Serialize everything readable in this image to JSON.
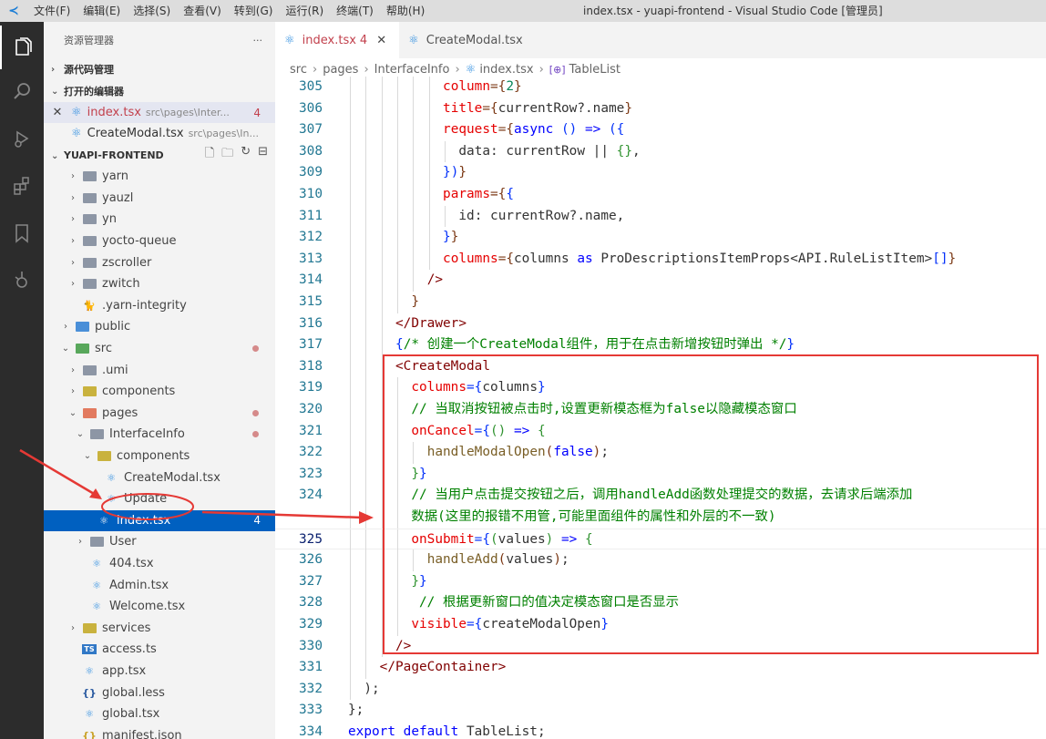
{
  "titlebar": {
    "menu": [
      "文件(F)",
      "编辑(E)",
      "选择(S)",
      "查看(V)",
      "转到(G)",
      "运行(R)",
      "终端(T)",
      "帮助(H)"
    ],
    "window_title": "index.tsx - yuapi-frontend - Visual Studio Code [管理员]"
  },
  "activity_bar": {
    "icons": [
      "explorer-icon",
      "search-icon",
      "run-debug-icon",
      "extensions-icon",
      "bookmark-icon",
      "git-graph-icon"
    ]
  },
  "sidebar": {
    "title": "资源管理器",
    "more": "···",
    "sections": {
      "source_control": "源代码管理",
      "open_editors": "打开的编辑器",
      "project": "YUAPI-FRONTEND"
    },
    "open_editors": [
      {
        "name": "index.tsx",
        "path": "src\\pages\\Inter...",
        "badge": "4"
      },
      {
        "name": "CreateModal.tsx",
        "path": "src\\pages\\In..."
      }
    ],
    "tree": [
      {
        "label": "yarn",
        "depth": 2,
        "type": "folder",
        "color": "gray",
        "chev": "›"
      },
      {
        "label": "yauzl",
        "depth": 2,
        "type": "folder",
        "color": "gray",
        "chev": "›"
      },
      {
        "label": "yn",
        "depth": 2,
        "type": "folder",
        "color": "gray",
        "chev": "›"
      },
      {
        "label": "yocto-queue",
        "depth": 2,
        "type": "folder",
        "color": "gray",
        "chev": "›"
      },
      {
        "label": "zscroller",
        "depth": 2,
        "type": "folder",
        "color": "gray",
        "chev": "›"
      },
      {
        "label": "zwitch",
        "depth": 2,
        "type": "folder",
        "color": "gray",
        "chev": "›"
      },
      {
        "label": ".yarn-integrity",
        "depth": 2,
        "type": "file",
        "icon": "yarn"
      },
      {
        "label": "public",
        "depth": 1,
        "type": "folder",
        "color": "blue",
        "chev": "›"
      },
      {
        "label": "src",
        "depth": 1,
        "type": "folder",
        "color": "green",
        "chev": "⌄",
        "dot": true
      },
      {
        "label": ".umi",
        "depth": 2,
        "type": "folder",
        "color": "gray",
        "chev": "›"
      },
      {
        "label": "components",
        "depth": 2,
        "type": "folder",
        "color": "yellow",
        "chev": "›"
      },
      {
        "label": "pages",
        "depth": 2,
        "type": "folder",
        "color": "red",
        "chev": "⌄",
        "dot": true
      },
      {
        "label": "InterfaceInfo",
        "depth": 3,
        "type": "folder",
        "color": "gray",
        "chev": "⌄",
        "dot": true
      },
      {
        "label": "components",
        "depth": 4,
        "type": "folder",
        "color": "yellow",
        "chev": "⌄"
      },
      {
        "label": "CreateModal.tsx",
        "depth": 5,
        "type": "react"
      },
      {
        "label": "Update",
        "depth": 5,
        "type": "react"
      },
      {
        "label": "index.tsx",
        "depth": 4,
        "type": "react",
        "selected": true,
        "badge": "4"
      },
      {
        "label": "User",
        "depth": 3,
        "type": "folder",
        "color": "gray",
        "chev": "›"
      },
      {
        "label": "404.tsx",
        "depth": 3,
        "type": "react"
      },
      {
        "label": "Admin.tsx",
        "depth": 3,
        "type": "react"
      },
      {
        "label": "Welcome.tsx",
        "depth": 3,
        "type": "react"
      },
      {
        "label": "services",
        "depth": 2,
        "type": "folder",
        "color": "yellow",
        "chev": "›"
      },
      {
        "label": "access.ts",
        "depth": 2,
        "type": "ts"
      },
      {
        "label": "app.tsx",
        "depth": 2,
        "type": "react"
      },
      {
        "label": "global.less",
        "depth": 2,
        "type": "less"
      },
      {
        "label": "global.tsx",
        "depth": 2,
        "type": "react"
      },
      {
        "label": "manifest.json",
        "depth": 2,
        "type": "json"
      }
    ]
  },
  "editor": {
    "tabs": [
      {
        "label": "index.tsx",
        "badge": "4",
        "active": true,
        "close": "✕"
      },
      {
        "label": "CreateModal.tsx",
        "active": false
      }
    ],
    "breadcrumb": [
      "src",
      "pages",
      "InterfaceInfo",
      "index.tsx",
      "TableList"
    ],
    "current_line": "325",
    "lines": [
      {
        "n": "305",
        "ind": 6,
        "t": [
          [
            "column",
            "at"
          ],
          [
            "={",
            "br3"
          ],
          [
            "2",
            "nm"
          ],
          [
            "}",
            "br3"
          ]
        ]
      },
      {
        "n": "306",
        "ind": 6,
        "t": [
          [
            "title",
            "at"
          ],
          [
            "={",
            "br3"
          ],
          [
            "currentRow?.name",
            "pl"
          ],
          [
            "}",
            "br3"
          ]
        ]
      },
      {
        "n": "307",
        "ind": 6,
        "t": [
          [
            "request",
            "at"
          ],
          [
            "={",
            "br3"
          ],
          [
            "async",
            "kw"
          ],
          [
            " ",
            "pl"
          ],
          [
            "()",
            "br1"
          ],
          [
            " => ",
            "kw"
          ],
          [
            "({",
            "br1"
          ]
        ]
      },
      {
        "n": "308",
        "ind": 7,
        "t": [
          [
            "data: currentRow || ",
            "pl"
          ],
          [
            "{}",
            "br2"
          ],
          [
            ",",
            "pl"
          ]
        ]
      },
      {
        "n": "309",
        "ind": 6,
        "t": [
          [
            "})",
            "br1"
          ],
          [
            "}",
            "br3"
          ]
        ]
      },
      {
        "n": "310",
        "ind": 6,
        "t": [
          [
            "params",
            "at"
          ],
          [
            "={",
            "br3"
          ],
          [
            "{",
            "br1"
          ]
        ]
      },
      {
        "n": "311",
        "ind": 7,
        "t": [
          [
            "id: currentRow?.name,",
            "pl"
          ]
        ]
      },
      {
        "n": "312",
        "ind": 6,
        "t": [
          [
            "}",
            "br1"
          ],
          [
            "}",
            "br3"
          ]
        ]
      },
      {
        "n": "313",
        "ind": 6,
        "t": [
          [
            "columns",
            "at"
          ],
          [
            "={",
            "br3"
          ],
          [
            "columns ",
            "pl"
          ],
          [
            "as",
            "kw"
          ],
          [
            " ProDescriptionsItemProps<API.RuleListItem>",
            "pl"
          ],
          [
            "[]",
            "br1"
          ],
          [
            "}",
            "br3"
          ]
        ]
      },
      {
        "n": "314",
        "ind": 5,
        "t": [
          [
            "/>",
            "tg"
          ]
        ]
      },
      {
        "n": "315",
        "ind": 4,
        "t": [
          [
            "}",
            "br3"
          ]
        ]
      },
      {
        "n": "316",
        "ind": 3,
        "t": [
          [
            "</Drawer>",
            "tg"
          ]
        ]
      },
      {
        "n": "317",
        "ind": 3,
        "t": [
          [
            "{",
            "br1"
          ],
          [
            "/* 创建一个CreateModal组件，用于在点击新增按钮时弹出 */",
            "cm"
          ],
          [
            "}",
            "br1"
          ]
        ]
      },
      {
        "n": "318",
        "ind": 3,
        "t": [
          [
            "<CreateModal",
            "tg"
          ]
        ]
      },
      {
        "n": "319",
        "ind": 4,
        "t": [
          [
            "columns",
            "at"
          ],
          [
            "={",
            "br1"
          ],
          [
            "columns",
            "pl"
          ],
          [
            "}",
            "br1"
          ]
        ]
      },
      {
        "n": "320",
        "ind": 4,
        "t": [
          [
            "// 当取消按钮被点击时,设置更新模态框为false以隐藏模态窗口",
            "cm"
          ]
        ]
      },
      {
        "n": "321",
        "ind": 4,
        "t": [
          [
            "onCancel",
            "at"
          ],
          [
            "={",
            "br1"
          ],
          [
            "()",
            "br2"
          ],
          [
            " => ",
            "kw"
          ],
          [
            "{",
            "br2"
          ]
        ]
      },
      {
        "n": "322",
        "ind": 5,
        "t": [
          [
            "handleModalOpen",
            "fn"
          ],
          [
            "(",
            "br3"
          ],
          [
            "false",
            "kw"
          ],
          [
            ")",
            "br3"
          ],
          [
            ";",
            "pl"
          ]
        ]
      },
      {
        "n": "323",
        "ind": 4,
        "t": [
          [
            "}",
            "br2"
          ],
          [
            "}",
            "br1"
          ]
        ]
      },
      {
        "n": "324",
        "ind": 4,
        "t": [
          [
            "// 当用户点击提交按钮之后，调用handleAdd函数处理提交的数据，去请求后端添加",
            "cm"
          ]
        ]
      },
      {
        "n": "",
        "ind": 4,
        "t": [
          [
            "数据(这里的报错不用管,可能里面组件的属性和外层的不一致)",
            "cm"
          ]
        ]
      },
      {
        "n": "325",
        "ind": 4,
        "t": [
          [
            "onSubmit",
            "at"
          ],
          [
            "={",
            "br1"
          ],
          [
            "(",
            "br2"
          ],
          [
            "values",
            "pl"
          ],
          [
            ")",
            "br2"
          ],
          [
            " => ",
            "kw"
          ],
          [
            "{",
            "br2"
          ]
        ]
      },
      {
        "n": "326",
        "ind": 5,
        "t": [
          [
            "handleAdd",
            "fn"
          ],
          [
            "(",
            "br3"
          ],
          [
            "values",
            "pl"
          ],
          [
            ")",
            "br3"
          ],
          [
            ";",
            "pl"
          ]
        ]
      },
      {
        "n": "327",
        "ind": 4,
        "t": [
          [
            "}",
            "br2"
          ],
          [
            "}",
            "br1"
          ]
        ]
      },
      {
        "n": "328",
        "ind": 4,
        "t": [
          [
            " // 根据更新窗口的值决定模态窗口是否显示",
            "cm"
          ]
        ]
      },
      {
        "n": "329",
        "ind": 4,
        "t": [
          [
            "visible",
            "at"
          ],
          [
            "={",
            "br1"
          ],
          [
            "createModalOpen",
            "pl"
          ],
          [
            "}",
            "br1"
          ]
        ]
      },
      {
        "n": "330",
        "ind": 3,
        "t": [
          [
            "/>",
            "tg"
          ]
        ]
      },
      {
        "n": "331",
        "ind": 2,
        "t": [
          [
            "</PageContainer>",
            "tg"
          ]
        ]
      },
      {
        "n": "332",
        "ind": 1,
        "t": [
          [
            ");",
            "pl"
          ]
        ]
      },
      {
        "n": "333",
        "ind": 0,
        "t": [
          [
            "};",
            "pl"
          ]
        ]
      },
      {
        "n": "334",
        "ind": 0,
        "t": [
          [
            "export ",
            "kw"
          ],
          [
            "default ",
            "kw"
          ],
          [
            "TableList;",
            "pl"
          ]
        ]
      }
    ]
  },
  "colors": {
    "accent": "#0060c0",
    "annotation_red": "#e53935",
    "modified_tab": "#c2404c"
  }
}
